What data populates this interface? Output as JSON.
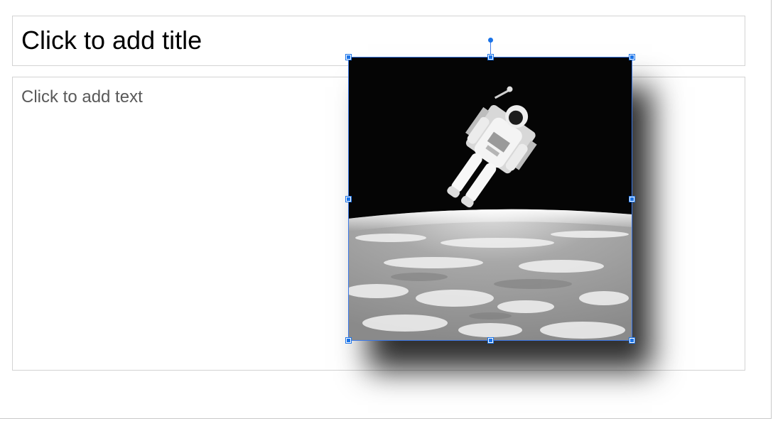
{
  "slide": {
    "title_placeholder": "Click to add title",
    "body_placeholder": "Click to add text"
  },
  "image": {
    "subject": "astronaut-floating-above-earth",
    "style": "grayscale",
    "selected": true,
    "shadow": true
  },
  "colors": {
    "selection": "#1a73e8",
    "placeholder_border": "#d3d3d3",
    "title_text": "#000000",
    "body_text": "#595959"
  }
}
